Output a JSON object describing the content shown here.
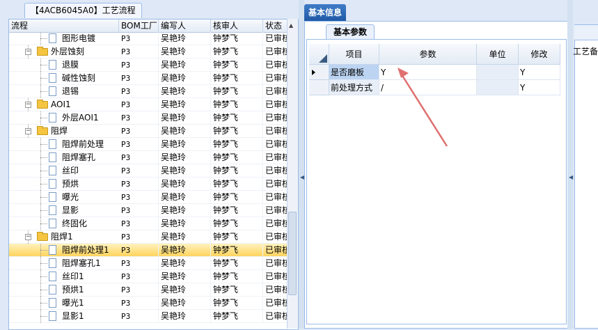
{
  "left_panel": {
    "tab_label": "【4ACB6045A0】工艺流程",
    "columns": [
      "流程",
      "BOM工厂",
      "编写人",
      "核审人",
      "状态"
    ],
    "rows": [
      {
        "label": "图形电镀",
        "kind": "doc",
        "level": 2,
        "bom": "P3",
        "writer": "吴艳玲",
        "reviewer": "钟梦飞",
        "status": "已审核",
        "selected": false
      },
      {
        "label": "外层蚀刻",
        "kind": "folder",
        "level": 1,
        "bom": "P3",
        "writer": "吴艳玲",
        "reviewer": "钟梦飞",
        "status": "已审核",
        "selected": false
      },
      {
        "label": "退膜",
        "kind": "doc",
        "level": 2,
        "bom": "P3",
        "writer": "吴艳玲",
        "reviewer": "钟梦飞",
        "status": "已审核",
        "selected": false
      },
      {
        "label": "碱性蚀刻",
        "kind": "doc",
        "level": 2,
        "bom": "P3",
        "writer": "吴艳玲",
        "reviewer": "钟梦飞",
        "status": "已审核",
        "selected": false
      },
      {
        "label": "退锡",
        "kind": "doc",
        "level": 2,
        "bom": "P3",
        "writer": "吴艳玲",
        "reviewer": "钟梦飞",
        "status": "已审核",
        "selected": false
      },
      {
        "label": "AOI1",
        "kind": "folder",
        "level": 1,
        "bom": "P3",
        "writer": "吴艳玲",
        "reviewer": "钟梦飞",
        "status": "已审核",
        "selected": false
      },
      {
        "label": "外层AOI1",
        "kind": "doc",
        "level": 2,
        "bom": "P3",
        "writer": "吴艳玲",
        "reviewer": "钟梦飞",
        "status": "已审核",
        "selected": false
      },
      {
        "label": "阻焊",
        "kind": "folder",
        "level": 1,
        "bom": "P3",
        "writer": "吴艳玲",
        "reviewer": "钟梦飞",
        "status": "已审核",
        "selected": false
      },
      {
        "label": "阻焊前处理",
        "kind": "doc",
        "level": 2,
        "bom": "P3",
        "writer": "吴艳玲",
        "reviewer": "钟梦飞",
        "status": "已审核",
        "selected": false
      },
      {
        "label": "阻焊塞孔",
        "kind": "doc",
        "level": 2,
        "bom": "P3",
        "writer": "吴艳玲",
        "reviewer": "钟梦飞",
        "status": "已审核",
        "selected": false
      },
      {
        "label": "丝印",
        "kind": "doc",
        "level": 2,
        "bom": "P3",
        "writer": "吴艳玲",
        "reviewer": "钟梦飞",
        "status": "已审核",
        "selected": false
      },
      {
        "label": "预烘",
        "kind": "doc",
        "level": 2,
        "bom": "P3",
        "writer": "吴艳玲",
        "reviewer": "钟梦飞",
        "status": "已审核",
        "selected": false
      },
      {
        "label": "曝光",
        "kind": "doc",
        "level": 2,
        "bom": "P3",
        "writer": "吴艳玲",
        "reviewer": "钟梦飞",
        "status": "已审核",
        "selected": false
      },
      {
        "label": "显影",
        "kind": "doc",
        "level": 2,
        "bom": "P3",
        "writer": "吴艳玲",
        "reviewer": "钟梦飞",
        "status": "已审核",
        "selected": false
      },
      {
        "label": "终固化",
        "kind": "doc",
        "level": 2,
        "bom": "P3",
        "writer": "吴艳玲",
        "reviewer": "钟梦飞",
        "status": "已审核",
        "selected": false
      },
      {
        "label": "阻焊1",
        "kind": "folder",
        "level": 1,
        "bom": "P3",
        "writer": "吴艳玲",
        "reviewer": "钟梦飞",
        "status": "已审核",
        "selected": false
      },
      {
        "label": "阻焊前处理1",
        "kind": "doc",
        "level": 2,
        "bom": "P3",
        "writer": "吴艳玲",
        "reviewer": "钟梦飞",
        "status": "已审核",
        "selected": true
      },
      {
        "label": "阻焊塞孔1",
        "kind": "doc",
        "level": 2,
        "bom": "P3",
        "writer": "吴艳玲",
        "reviewer": "钟梦飞",
        "status": "已审核",
        "selected": false
      },
      {
        "label": "丝印1",
        "kind": "doc",
        "level": 2,
        "bom": "P3",
        "writer": "吴艳玲",
        "reviewer": "钟梦飞",
        "status": "已审核",
        "selected": false
      },
      {
        "label": "预烘1",
        "kind": "doc",
        "level": 2,
        "bom": "P3",
        "writer": "吴艳玲",
        "reviewer": "钟梦飞",
        "status": "已审核",
        "selected": false
      },
      {
        "label": "曝光1",
        "kind": "doc",
        "level": 2,
        "bom": "P3",
        "writer": "吴艳玲",
        "reviewer": "钟梦飞",
        "status": "已审核",
        "selected": false
      },
      {
        "label": "显影1",
        "kind": "doc",
        "level": 2,
        "bom": "P3",
        "writer": "吴艳玲",
        "reviewer": "钟梦飞",
        "status": "已审核",
        "selected": false
      }
    ]
  },
  "middle_panel": {
    "tab_label": "基本信息",
    "sub_tab_label": "基本参数",
    "columns": [
      "项目",
      "参数",
      "单位",
      "修改"
    ],
    "rows": [
      {
        "item": "是否磨板",
        "param": "Y",
        "unit": "",
        "modify": "Y",
        "current": true
      },
      {
        "item": "前处理方式",
        "param": "/",
        "unit": "",
        "modify": "Y",
        "current": false
      }
    ]
  },
  "right_panel": {
    "label": "工艺备"
  },
  "colors": {
    "selection_row": "#ffd45e",
    "tab_blue": "#1f59a6",
    "annotation_arrow": "#e07070"
  },
  "icons": [
    "folder-icon",
    "document-icon",
    "row-pointer-icon",
    "splitter-arrow-icon"
  ]
}
